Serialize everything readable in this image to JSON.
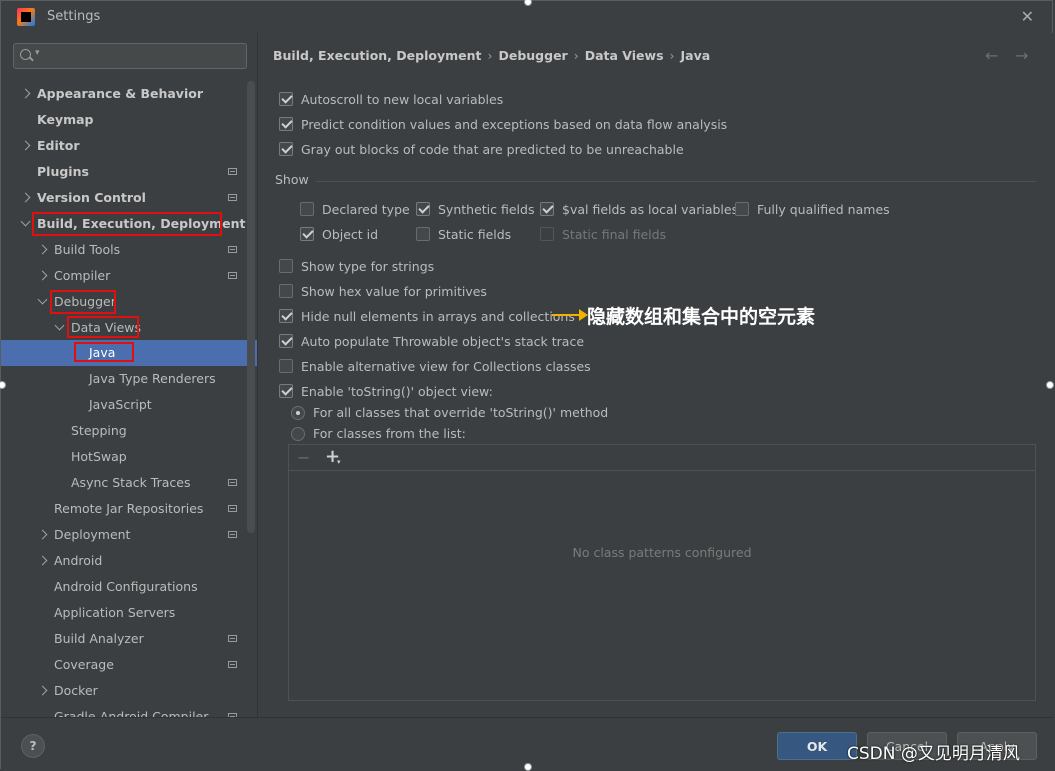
{
  "window": {
    "title": "Settings"
  },
  "sidebar": {
    "search_placeholder": "",
    "items": [
      {
        "label": "Appearance & Behavior"
      },
      {
        "label": "Keymap"
      },
      {
        "label": "Editor"
      },
      {
        "label": "Plugins"
      },
      {
        "label": "Version Control"
      },
      {
        "label": "Build, Execution, Deployment"
      },
      {
        "label": "Build Tools"
      },
      {
        "label": "Compiler"
      },
      {
        "label": "Debugger"
      },
      {
        "label": "Data Views"
      },
      {
        "label": "Java"
      },
      {
        "label": "Java Type Renderers"
      },
      {
        "label": "JavaScript"
      },
      {
        "label": "Stepping"
      },
      {
        "label": "HotSwap"
      },
      {
        "label": "Async Stack Traces"
      },
      {
        "label": "Remote Jar Repositories"
      },
      {
        "label": "Deployment"
      },
      {
        "label": "Android"
      },
      {
        "label": "Android Configurations"
      },
      {
        "label": "Application Servers"
      },
      {
        "label": "Build Analyzer"
      },
      {
        "label": "Coverage"
      },
      {
        "label": "Docker"
      },
      {
        "label": "Gradle-Android Compiler"
      }
    ]
  },
  "breadcrumb": [
    "Build, Execution, Deployment",
    "Debugger",
    "Data Views",
    "Java"
  ],
  "options_top": [
    {
      "label": "Autoscroll to new local variables",
      "checked": true
    },
    {
      "label": "Predict condition values and exceptions based on data flow analysis",
      "checked": true
    },
    {
      "label": "Gray out blocks of code that are predicted to be unreachable",
      "checked": true
    }
  ],
  "show_section": {
    "title": "Show",
    "items": [
      {
        "label": "Declared type",
        "checked": false
      },
      {
        "label": "Synthetic fields",
        "checked": true
      },
      {
        "label": "$val fields as local variables",
        "checked": true
      },
      {
        "label": "Fully qualified names",
        "checked": false
      },
      {
        "label": "Object id",
        "checked": true
      },
      {
        "label": "Static fields",
        "checked": false
      },
      {
        "label": "Static final fields",
        "checked": false,
        "disabled": true
      }
    ]
  },
  "options_bottom": [
    {
      "label": "Show type for strings",
      "checked": false
    },
    {
      "label": "Show hex value for primitives",
      "checked": false
    },
    {
      "label": "Hide null elements in arrays and collections",
      "checked": true
    },
    {
      "label": "Auto populate Throwable object's stack trace",
      "checked": true
    },
    {
      "label": "Enable alternative view for Collections classes",
      "checked": false
    },
    {
      "label": "Enable 'toString()' object view:",
      "checked": true
    }
  ],
  "radios": [
    {
      "label": "For all classes that override 'toString()' method",
      "selected": true
    },
    {
      "label": "For classes from the list:",
      "selected": false
    }
  ],
  "class_list": {
    "empty_text": "No class patterns configured"
  },
  "annotation": {
    "text": "隐藏数组和集合中的空元素"
  },
  "footer": {
    "help": "?",
    "ok": "OK",
    "cancel": "Cancel",
    "apply": "Apply"
  },
  "watermark": "CSDN @又见明月清风"
}
